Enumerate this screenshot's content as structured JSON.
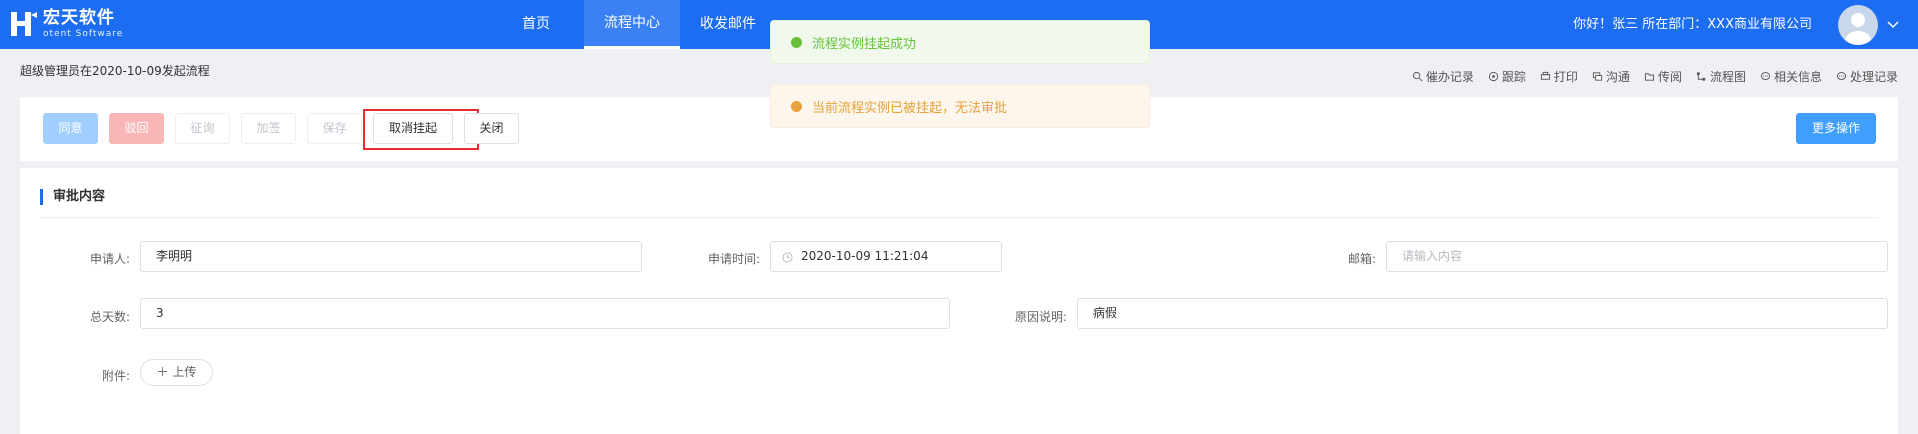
{
  "brand": {
    "name_cn": "宏天软件",
    "name_en": "otent Software",
    "primary_color": "#1c6df2"
  },
  "nav": {
    "items": [
      {
        "label": "首页"
      },
      {
        "label": "流程中心"
      },
      {
        "label": "收发邮件"
      }
    ],
    "active_index": 1
  },
  "user": {
    "greeting": "你好！张三 所在部门：XXX商业有限公司"
  },
  "subheader": {
    "title": "超级管理员在2020-10-09发起流程",
    "actions": [
      {
        "label": "催办记录",
        "icon": "search-icon"
      },
      {
        "label": "跟踪",
        "icon": "track-icon"
      },
      {
        "label": "打印",
        "icon": "print-icon"
      },
      {
        "label": "沟通",
        "icon": "chat-icon"
      },
      {
        "label": "传阅",
        "icon": "folder-icon"
      },
      {
        "label": "流程图",
        "icon": "flowchart-icon"
      },
      {
        "label": "相关信息",
        "icon": "info-icon"
      },
      {
        "label": "处理记录",
        "icon": "record-icon"
      }
    ]
  },
  "toolbar": {
    "agree": "同意",
    "reject": "驳回",
    "consult": "征询",
    "cosign": "加签",
    "save": "保存",
    "cancel_suspend": "取消挂起",
    "close": "关闭",
    "more": "更多操作"
  },
  "form": {
    "section_title": "审批内容",
    "applicant": {
      "label": "申请人:",
      "value": "李明明"
    },
    "apply_time": {
      "label": "申请时间:",
      "value": "2020-10-09 11:21:04"
    },
    "email": {
      "label": "邮箱:",
      "placeholder": "请输入内容"
    },
    "total_days": {
      "label": "总天数:",
      "value": "3"
    },
    "reason": {
      "label": "原因说明:",
      "value": "病假"
    },
    "attachment": {
      "label": "附件:",
      "upload_label": "上传"
    }
  },
  "toasts": {
    "success": {
      "text": "流程实例挂起成功",
      "color": "#67c23a"
    },
    "warning": {
      "text": "当前流程实例已被挂起，无法审批",
      "color": "#e6a23c"
    }
  }
}
